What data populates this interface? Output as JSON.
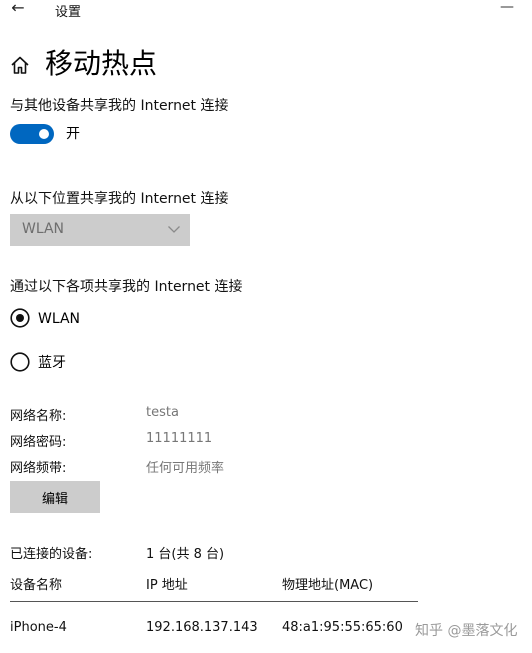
{
  "window": {
    "title": "设置",
    "back_glyph": "←",
    "minimize_glyph": "—"
  },
  "page": {
    "title": "移动热点"
  },
  "share": {
    "label": "与其他设备共享我的 Internet 连接",
    "toggle_state": "开",
    "toggle_on": true
  },
  "share_from": {
    "label": "从以下位置共享我的 Internet 连接",
    "selected": "WLAN"
  },
  "share_over": {
    "label": "通过以下各项共享我的 Internet 连接",
    "options": [
      {
        "label": "WLAN",
        "selected": true
      },
      {
        "label": "蓝牙",
        "selected": false
      }
    ]
  },
  "network": {
    "name_key": "网络名称:",
    "name_value": "testa",
    "password_key": "网络密码:",
    "password_value": "11111111",
    "band_key": "网络频带:",
    "band_value": "任何可用频率",
    "edit_label": "编辑"
  },
  "devices": {
    "connected_key": "已连接的设备:",
    "connected_value": "1 台(共 8 台)",
    "columns": [
      "设备名称",
      "IP 地址",
      "物理地址(MAC)"
    ],
    "rows": [
      {
        "name": "iPhone-4",
        "ip": "192.168.137.143",
        "mac": "48:a1:95:55:65:60"
      }
    ]
  },
  "watermark": "知乎 @墨落文化",
  "colors": {
    "accent": "#0067c0",
    "control_bg": "#cccccc"
  },
  "icons": {
    "home": "home-icon",
    "back": "back-arrow-icon",
    "chevron": "chevron-down-icon"
  }
}
